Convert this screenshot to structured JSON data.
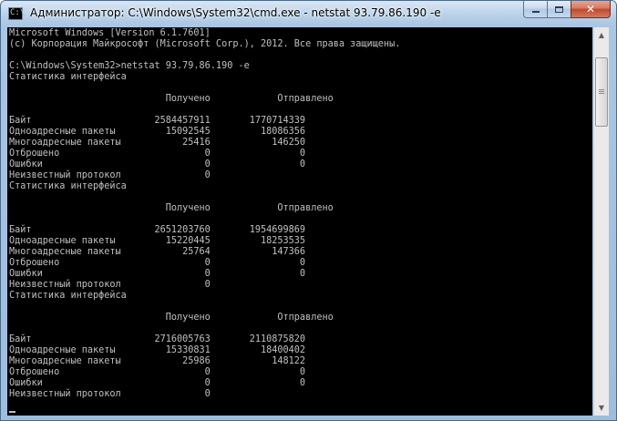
{
  "window": {
    "title": "Администратор: C:\\Windows\\System32\\cmd.exe - netstat  93.79.86.190 -e",
    "icon": "cmd-icon",
    "icon_glyph": "C:\\"
  },
  "caption_buttons": {
    "minimize": "minimize-icon",
    "maximize": "maximize-icon",
    "close": "close-icon",
    "close_glyph": "✕"
  },
  "console": {
    "lines": [
      "Microsoft Windows [Version 6.1.7601]",
      "(c) Корпорация Майкрософт (Microsoft Corp.), 2012. Все права защищены.",
      "",
      "C:\\Windows\\System32>netstat 93.79.86.190 -e",
      "Статистика интерфейса",
      "",
      "                            Получено            Отправлено",
      "",
      "Байт                      2584457911       1770714339",
      "Одноадресные пакеты         15092545         18086356",
      "Многоадресные пакеты           25416           146250",
      "Отброшено                          0                0",
      "Ошибки                             0                0",
      "Неизвестный протокол               0",
      "Статистика интерфейса",
      "",
      "                            Получено            Отправлено",
      "",
      "Байт                      2651203760       1954699869",
      "Одноадресные пакеты         15220445         18253535",
      "Многоадресные пакеты           25764           147366",
      "Отброшено                          0                0",
      "Ошибки                             0                0",
      "Неизвестный протокол               0",
      "Статистика интерфейса",
      "",
      "                            Получено            Отправлено",
      "",
      "Байт                      2716005763       2110875820",
      "Одноадресные пакеты         15330831         18400402",
      "Многоадресные пакеты           25986           148122",
      "Отброшено                          0                0",
      "Ошибки                             0                0",
      "Неизвестный протокол               0"
    ]
  },
  "scrollbar": {
    "up_arrow": "▲",
    "down_arrow": "▼",
    "position_fraction": 0.05
  },
  "colors": {
    "console_bg": "#000000",
    "console_fg": "#c0c0c0",
    "titlebar": "#bcd3ea",
    "close_button": "#c04a2d"
  }
}
